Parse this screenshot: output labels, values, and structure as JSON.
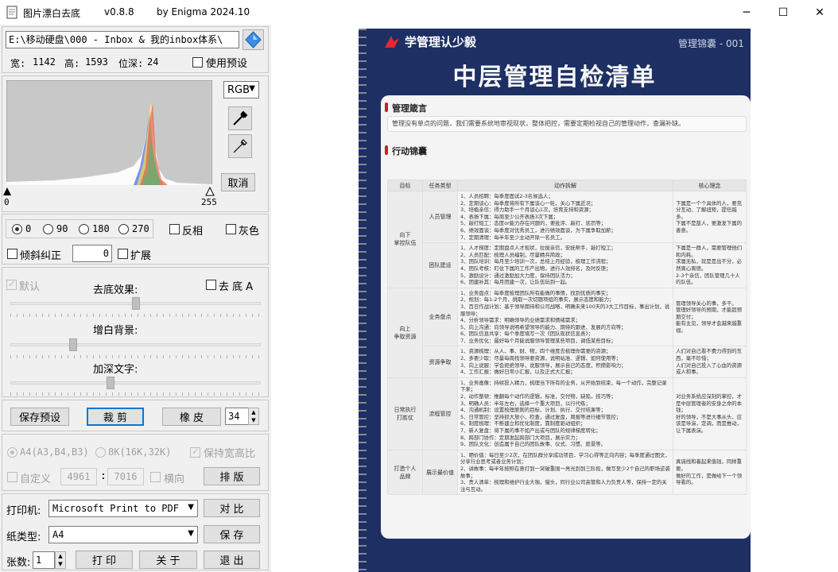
{
  "window": {
    "title": "图片漂白去底",
    "version": "v0.8.8",
    "author": "by Enigma 2024.10",
    "controls": {
      "minimize": "─",
      "maximize": "☐",
      "close": "✕"
    }
  },
  "file": {
    "path": "E:\\移动硬盘\\000 - Inbox & 我的inbox体系\\",
    "width_label": "宽:",
    "width": "1142",
    "height_label": "高:",
    "height": "1593",
    "depth_label": "位深:",
    "depth": "24",
    "use_preset": "使用预设"
  },
  "histogram": {
    "channel": "RGB",
    "cancel": "取消",
    "min": "0",
    "max": "255"
  },
  "rotation": {
    "options": [
      "0",
      "90",
      "180",
      "270"
    ],
    "selected": "0",
    "invert": "反相",
    "gray": "灰色",
    "deskew": "倾斜纠正",
    "angle": "0",
    "expand": "扩展"
  },
  "effects": {
    "default": "默认",
    "remove_bg_label": "去底效果:",
    "remove_a": "去 底 A",
    "whiten_label": "增白背景:",
    "darken_label": "加深文字:",
    "remove_level": 0.5,
    "whiten_level": 0.25,
    "darken_level": 0.4
  },
  "actions": {
    "save_preset": "保存预设",
    "crop": "裁 剪",
    "eraser": "橡 皮",
    "eraser_size": "34"
  },
  "paper": {
    "a4": "A4(A3,B4,B3)",
    "k8": "8K(16K,32K)",
    "keep_ratio": "保持宽高比",
    "custom": "自定义",
    "custom_w": "4961",
    "custom_h": "7016",
    "sep": ":",
    "landscape": "横向",
    "layout": "排 版"
  },
  "print": {
    "printer_label": "打印机:",
    "printer": "Microsoft Print to PDF",
    "compare": "对 比",
    "paper_label": "纸类型:",
    "paper": "A4",
    "save": "保 存",
    "copies_label": "张数:",
    "copies": "1",
    "print": "打 印",
    "about": "关 于",
    "exit": "退 出"
  },
  "document": {
    "brand": "学管理认少毅",
    "header_right": "管理锦囊 - 001",
    "title": "中层管理自检清单",
    "section1": "管理箴言",
    "motto": "管理没有单点的问题，我们需要系统地审视现状，整体把控，需要定期检视自己的管理动作，查漏补缺。",
    "section2": "行动锦囊",
    "columns": [
      "目标",
      "任务类型",
      "动作拆解",
      "核心理念"
    ],
    "rows": [
      {
        "goal": "向下\n掌控队伍",
        "type": "人员管理",
        "actions": "1、人员招聘：每季度面试2-3名候选人；\n2、定期谈心：每季度将所有下属谈心一轮，关心下属近况；\n3、培植亲信：得力助手一个月谈心1次，培育支持和资源；\n4、表扬下属：每周至少公开表扬3次下属；\n5、敲打短工：态度or能力存在问题的，要批评、敲打、惩罚等；\n6、绩效面谈：每季度对优秀员工，进行绩效面谈，为下属争取加薪；\n7、定期清理：每半年至少主动开除一名员工。",
        "idea": "下属是一个个具体的人，要充分互动、了解扭矩，提任越多。\n下属不是敌人，要激发下属的善意。"
      },
      {
        "goal": "",
        "type": "团队建设",
        "actions": "1、人才梯度：定期盘点人才现状，拉拔亲信，安抚帮手、敲打短工；\n2、人员匹配：梳理人员编制，尽量精兵简政；\n3、团队培训：每月至少培训一次，总结上月经验，梳理工作流程；\n4、团队考核：盯住下属的工作产出物，进行人效排名，及时反馈；\n5、激励设计：通过激励加大力度，保持团队活力；\n6、团建补其：每月团建一次，让队伍玩到一起。",
        "idea": "下属是一群人，需要管理他们和内耗。\n求属无私，就是是出不分，必然离心离德。\n2-3个亲信，团队管理几十人的队伍。"
      },
      {
        "goal": "向上\n争取资源",
        "type": "业务盘点",
        "actions": "1、业务盘点：每季度梳理团队所有能做的事情，找到优质的事实；\n2、规划：每1-2个月，挑取一次切题项组的事实，展示态度和能力；\n3、百日作战计划：基于领导期待和公司战略，明确未来100天的3大工作目标，事出计划，说服领导；\n4、分析领导需求：明确领导的业绩需求和情绪需求；\n5、向上沟通：向领导说明希望领导的能力、期待的跟进、发展的方向等；\n6、团队信息共享：每个季度填写一次《团队现状信息表》；\n7、业务优化：最好每个月能说服领导管理某些项目，调低某些目标；",
        "idea": "管理领导关心的事，多干。\n管理好领导的预期，才能超预期交付；\n能有主见，领导才会越来越重视。"
      },
      {
        "goal": "",
        "type": "资源争取",
        "actions": "1、资源梳理：从人、事、财、物，四个维度去梳理你需要的资源；\n2、多要少取：尽量每周找领导要资源，说明站准、逻辑、如何使用等；\n3、向上说服：学会拒绝领导，说服领导，展示自己的态度，积攒影响力；\n4、工作汇报：做好日常小汇报，以及正式大汇报；",
        "idea": "人们对自己看不费力得到的东西，毫不珍惜；\n人们对自己投入了心血的资源或人和事。"
      },
      {
        "goal": "日常执行\n打胜仗",
        "type": "流程管控",
        "actions": "1、业务画像：持续投入精力，梳理当下所有的业务，从开始到结束，每一个动作，完整记录下来；\n2、动作整顿：推翻每个动作的逻辑，标准，交付物，缺陷，技巧等；\n3、明确人员：半年左右，选择一个重大项目，以行代练；\n4、沟通机制：设置梳理原则的目标、计划、执行、交付结果等；\n5、日常管控：坚持抓大放小，检查，通过复盘，周报等进行细节管控；\n6、制度梳理：不断建立和优化制度，靠制度驱动组织；\n7、新人复盘：将下属的事不如产出或与团队的规律梯度转化；\n8、跨部门协作：定期发起跨部门大项目，展示实力；\n9、团队文化：创造属于自己的团队故事、仪式、习惯、愿景等。",
        "idea": "对业务系统应深刻的掌控，才是中层管理者的安身之命的本钱；\n好的领导，不是大事从头，应该是导演，定调，而是推动，让下属表演。"
      },
      {
        "goal": "打造个人\n品牌",
        "type": "展示最价值",
        "actions": "1、晒价值：每日至少2次，在团队群分享成功项目，学习心得等正向内容；每季度通过图文，分享行业思考或者业务计划；\n2、讲故事：每半年按照在意打到一突破重围一亮光到到三阶段，做写至少2个自己的职场逆袭故事；\n3、责人清单：梳理和维护行业大咖，猎头，同行业公司高管和人力负责人等，保持一定的关注与互动。",
        "idea": "真诚线和着起来值钱，同样重要。\n做好的工作，是做给下一个领导看的。"
      }
    ]
  }
}
